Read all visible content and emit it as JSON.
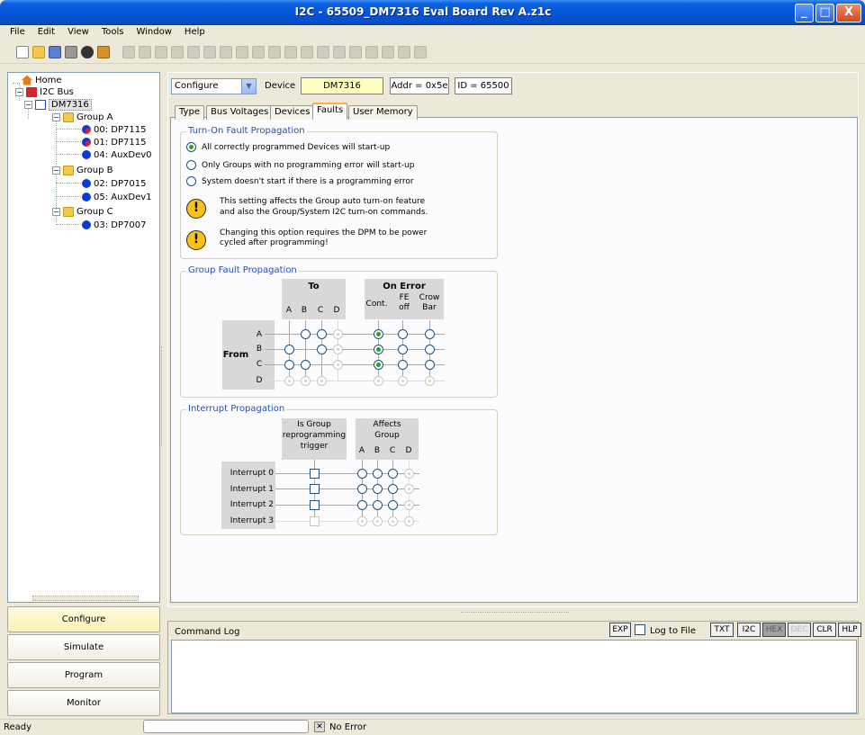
{
  "window": {
    "title": "I2C - 65509_DM7316 Eval Board Rev A.z1c",
    "controls": {
      "minimize": "_",
      "maximize": "□",
      "close": "X"
    }
  },
  "menu": [
    "File",
    "Edit",
    "View",
    "Tools",
    "Window",
    "Help"
  ],
  "tree": {
    "home": "Home",
    "bus": "I2C Bus",
    "device": "DM7316",
    "groups": [
      {
        "label": "Group A",
        "children": [
          "00: DP7115",
          "01: DP7115",
          "04: AuxDev0"
        ]
      },
      {
        "label": "Group B",
        "children": [
          "02: DP7015",
          "05: AuxDev1"
        ]
      },
      {
        "label": "Group C",
        "children": [
          "03: DP7007"
        ]
      }
    ]
  },
  "nav_buttons": [
    "Configure",
    "Simulate",
    "Program",
    "Monitor"
  ],
  "device_bar": {
    "mode": "Configure",
    "device_label": "Device",
    "device_name": "DM7316",
    "addr": "Addr = 0x5e",
    "id": "ID = 65500"
  },
  "tabs": [
    "Type",
    "Bus Voltages",
    "Devices",
    "Faults",
    "User Memory"
  ],
  "active_tab": "Faults",
  "turn_on": {
    "title": "Turn-On Fault Propagation",
    "options": [
      "All correctly programmed Devices will start-up",
      "Only Groups with no programming error will start-up",
      "System doesn't start if there is a programming error"
    ],
    "selected": 0,
    "warning1": [
      "This setting affects the Group auto turn-on feature",
      "and also the Group/System I2C turn-on commands."
    ],
    "warning2": [
      "Changing this option requires  the DPM to be power",
      "cycled  after programming!"
    ]
  },
  "group_fault": {
    "title": "Group Fault Propagation",
    "to_label": "To",
    "to_cols": [
      "A",
      "B",
      "C",
      "D"
    ],
    "on_error_label": "On Error",
    "on_error_cols": [
      "Cont.",
      "FE off",
      "Crow Bar"
    ],
    "from_label": "From",
    "rows": [
      "A",
      "B",
      "C",
      "D"
    ]
  },
  "interrupt": {
    "title": "Interrupt Propagation",
    "trigger_header": [
      "Is Group",
      "reprogramming",
      "trigger"
    ],
    "affects_header": [
      "Affects",
      "Group"
    ],
    "cols": [
      "A",
      "B",
      "C",
      "D"
    ],
    "rows": [
      "Interrupt 0",
      "Interrupt 1",
      "Interrupt 2",
      "Interrupt 3"
    ]
  },
  "command_log": {
    "title": "Command Log",
    "exp": "EXP",
    "log_to_file": "Log to File",
    "buttons": [
      "TXT",
      "I2C",
      "HEX",
      "DEC",
      "CLR",
      "HLP"
    ]
  },
  "status": {
    "ready": "Ready",
    "error": "No Error"
  }
}
